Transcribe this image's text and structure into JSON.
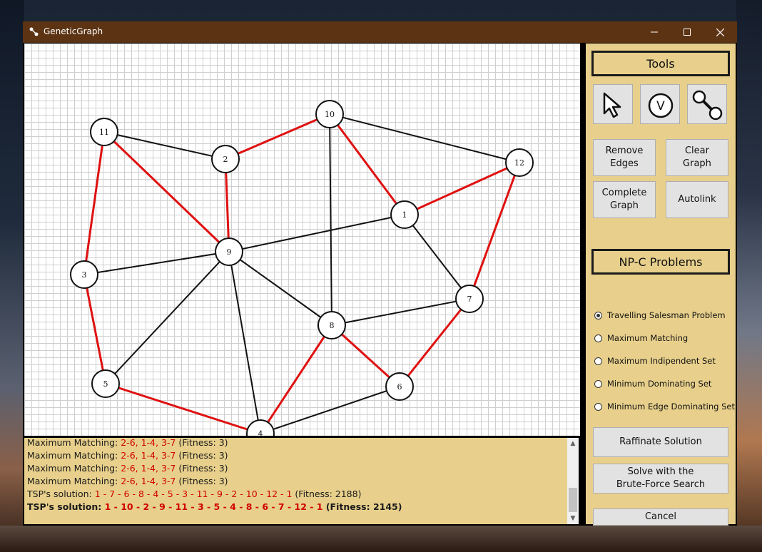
{
  "window": {
    "title": "GeneticGraph",
    "controls": {
      "minimize": "—",
      "maximize": "☐",
      "close": "✕"
    }
  },
  "graph": {
    "colors": {
      "edge": "#111111",
      "tour_edge": "#e01010",
      "node_fill": "#ffffff",
      "node_stroke": "#111111"
    },
    "nodes": [
      {
        "id": "1",
        "label": "1"
      },
      {
        "id": "2",
        "label": "2"
      },
      {
        "id": "3",
        "label": "3"
      },
      {
        "id": "4",
        "label": "4"
      },
      {
        "id": "5",
        "label": "5"
      },
      {
        "id": "6",
        "label": "6"
      },
      {
        "id": "7",
        "label": "7"
      },
      {
        "id": "8",
        "label": "8"
      },
      {
        "id": "9",
        "label": "9"
      },
      {
        "id": "10",
        "label": "10"
      },
      {
        "id": "11",
        "label": "11"
      },
      {
        "id": "12",
        "label": "12"
      }
    ],
    "edges": [
      {
        "a": "11",
        "b": "2",
        "tour": false
      },
      {
        "a": "11",
        "b": "9",
        "tour": true
      },
      {
        "a": "11",
        "b": "3",
        "tour": true
      },
      {
        "a": "2",
        "b": "10",
        "tour": true
      },
      {
        "a": "2",
        "b": "9",
        "tour": true
      },
      {
        "a": "10",
        "b": "12",
        "tour": false
      },
      {
        "a": "10",
        "b": "1",
        "tour": true
      },
      {
        "a": "10",
        "b": "8",
        "tour": false
      },
      {
        "a": "12",
        "b": "1",
        "tour": true
      },
      {
        "a": "12",
        "b": "7",
        "tour": true
      },
      {
        "a": "1",
        "b": "9",
        "tour": false
      },
      {
        "a": "1",
        "b": "7",
        "tour": false
      },
      {
        "a": "9",
        "b": "3",
        "tour": false
      },
      {
        "a": "9",
        "b": "8",
        "tour": false
      },
      {
        "a": "9",
        "b": "5",
        "tour": false
      },
      {
        "a": "9",
        "b": "4",
        "tour": false
      },
      {
        "a": "3",
        "b": "5",
        "tour": true
      },
      {
        "a": "7",
        "b": "8",
        "tour": false
      },
      {
        "a": "7",
        "b": "6",
        "tour": true
      },
      {
        "a": "8",
        "b": "6",
        "tour": true
      },
      {
        "a": "8",
        "b": "4",
        "tour": true
      },
      {
        "a": "5",
        "b": "4",
        "tour": true
      },
      {
        "a": "4",
        "b": "6",
        "tour": false
      }
    ]
  },
  "console": {
    "lines": [
      {
        "prefix": "Maximum Matching: ",
        "solution": "2-6, 1-4, 3-7",
        "suffix": " (Fitness: 3)",
        "bold": false
      },
      {
        "prefix": "Maximum Matching: ",
        "solution": "2-6, 1-4, 3-7",
        "suffix": " (Fitness: 3)",
        "bold": false
      },
      {
        "prefix": "Maximum Matching: ",
        "solution": "2-6, 1-4, 3-7",
        "suffix": " (Fitness: 3)",
        "bold": false
      },
      {
        "prefix": "Maximum Matching: ",
        "solution": "2-6, 1-4, 3-7",
        "suffix": " (Fitness: 3)",
        "bold": false
      },
      {
        "prefix": "TSP's solution: ",
        "solution": "1 - 7 - 6 - 8 - 4 - 5 - 3 - 11 - 9 - 2 - 10 - 12 - 1",
        "suffix": " (Fitness: 2188)",
        "bold": false
      },
      {
        "prefix": "TSP's solution: ",
        "solution": "1 - 10 - 2 - 9 - 11 - 3 - 5 - 4 - 8 - 6 - 7 - 12 - 1",
        "suffix": " (Fitness: 2145)",
        "bold": true
      }
    ],
    "scroll_up": "▲",
    "scroll_down": "▼"
  },
  "tools": {
    "header": "Tools",
    "icons": [
      "cursor-arrow-icon",
      "add-vertex-icon",
      "add-edge-icon"
    ],
    "vertex_glyph": "V",
    "remove_edges": "Remove\nEdges",
    "clear_graph": "Clear\nGraph",
    "complete_graph": "Complete\nGraph",
    "autolink": "Autolink"
  },
  "problems": {
    "header": "NP-C Problems",
    "options": [
      {
        "label": "Travelling Salesman Problem",
        "checked": true
      },
      {
        "label": "Maximum Matching",
        "checked": false
      },
      {
        "label": "Maximum Indipendent Set",
        "checked": false
      },
      {
        "label": "Minimum Dominating Set",
        "checked": false
      },
      {
        "label": "Minimum Edge Dominating Set",
        "checked": false
      }
    ],
    "raffinate": "Raffinate Solution",
    "brute_force": "Solve with the\nBrute-Force Search",
    "cancel": "Cancel"
  }
}
